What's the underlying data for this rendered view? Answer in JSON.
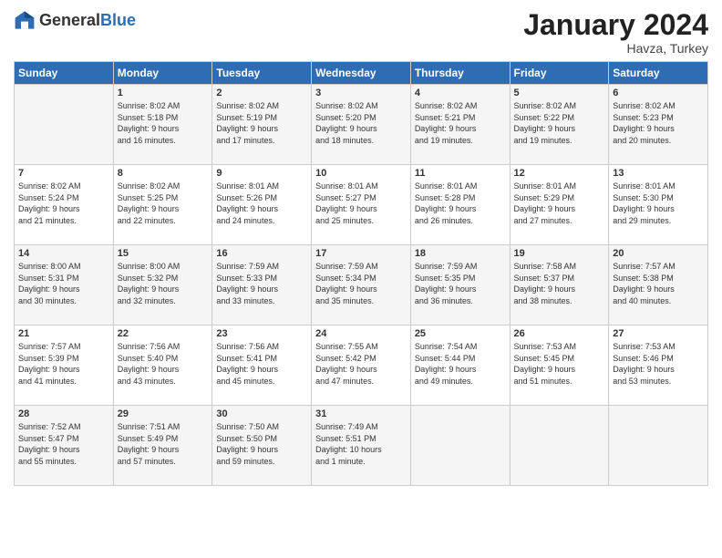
{
  "header": {
    "logo_general": "General",
    "logo_blue": "Blue",
    "month_title": "January 2024",
    "location": "Havza, Turkey"
  },
  "days_of_week": [
    "Sunday",
    "Monday",
    "Tuesday",
    "Wednesday",
    "Thursday",
    "Friday",
    "Saturday"
  ],
  "weeks": [
    [
      {
        "day": "",
        "info": ""
      },
      {
        "day": "1",
        "info": "Sunrise: 8:02 AM\nSunset: 5:18 PM\nDaylight: 9 hours\nand 16 minutes."
      },
      {
        "day": "2",
        "info": "Sunrise: 8:02 AM\nSunset: 5:19 PM\nDaylight: 9 hours\nand 17 minutes."
      },
      {
        "day": "3",
        "info": "Sunrise: 8:02 AM\nSunset: 5:20 PM\nDaylight: 9 hours\nand 18 minutes."
      },
      {
        "day": "4",
        "info": "Sunrise: 8:02 AM\nSunset: 5:21 PM\nDaylight: 9 hours\nand 19 minutes."
      },
      {
        "day": "5",
        "info": "Sunrise: 8:02 AM\nSunset: 5:22 PM\nDaylight: 9 hours\nand 19 minutes."
      },
      {
        "day": "6",
        "info": "Sunrise: 8:02 AM\nSunset: 5:23 PM\nDaylight: 9 hours\nand 20 minutes."
      }
    ],
    [
      {
        "day": "7",
        "info": "Sunrise: 8:02 AM\nSunset: 5:24 PM\nDaylight: 9 hours\nand 21 minutes."
      },
      {
        "day": "8",
        "info": "Sunrise: 8:02 AM\nSunset: 5:25 PM\nDaylight: 9 hours\nand 22 minutes."
      },
      {
        "day": "9",
        "info": "Sunrise: 8:01 AM\nSunset: 5:26 PM\nDaylight: 9 hours\nand 24 minutes."
      },
      {
        "day": "10",
        "info": "Sunrise: 8:01 AM\nSunset: 5:27 PM\nDaylight: 9 hours\nand 25 minutes."
      },
      {
        "day": "11",
        "info": "Sunrise: 8:01 AM\nSunset: 5:28 PM\nDaylight: 9 hours\nand 26 minutes."
      },
      {
        "day": "12",
        "info": "Sunrise: 8:01 AM\nSunset: 5:29 PM\nDaylight: 9 hours\nand 27 minutes."
      },
      {
        "day": "13",
        "info": "Sunrise: 8:01 AM\nSunset: 5:30 PM\nDaylight: 9 hours\nand 29 minutes."
      }
    ],
    [
      {
        "day": "14",
        "info": "Sunrise: 8:00 AM\nSunset: 5:31 PM\nDaylight: 9 hours\nand 30 minutes."
      },
      {
        "day": "15",
        "info": "Sunrise: 8:00 AM\nSunset: 5:32 PM\nDaylight: 9 hours\nand 32 minutes."
      },
      {
        "day": "16",
        "info": "Sunrise: 7:59 AM\nSunset: 5:33 PM\nDaylight: 9 hours\nand 33 minutes."
      },
      {
        "day": "17",
        "info": "Sunrise: 7:59 AM\nSunset: 5:34 PM\nDaylight: 9 hours\nand 35 minutes."
      },
      {
        "day": "18",
        "info": "Sunrise: 7:59 AM\nSunset: 5:35 PM\nDaylight: 9 hours\nand 36 minutes."
      },
      {
        "day": "19",
        "info": "Sunrise: 7:58 AM\nSunset: 5:37 PM\nDaylight: 9 hours\nand 38 minutes."
      },
      {
        "day": "20",
        "info": "Sunrise: 7:57 AM\nSunset: 5:38 PM\nDaylight: 9 hours\nand 40 minutes."
      }
    ],
    [
      {
        "day": "21",
        "info": "Sunrise: 7:57 AM\nSunset: 5:39 PM\nDaylight: 9 hours\nand 41 minutes."
      },
      {
        "day": "22",
        "info": "Sunrise: 7:56 AM\nSunset: 5:40 PM\nDaylight: 9 hours\nand 43 minutes."
      },
      {
        "day": "23",
        "info": "Sunrise: 7:56 AM\nSunset: 5:41 PM\nDaylight: 9 hours\nand 45 minutes."
      },
      {
        "day": "24",
        "info": "Sunrise: 7:55 AM\nSunset: 5:42 PM\nDaylight: 9 hours\nand 47 minutes."
      },
      {
        "day": "25",
        "info": "Sunrise: 7:54 AM\nSunset: 5:44 PM\nDaylight: 9 hours\nand 49 minutes."
      },
      {
        "day": "26",
        "info": "Sunrise: 7:53 AM\nSunset: 5:45 PM\nDaylight: 9 hours\nand 51 minutes."
      },
      {
        "day": "27",
        "info": "Sunrise: 7:53 AM\nSunset: 5:46 PM\nDaylight: 9 hours\nand 53 minutes."
      }
    ],
    [
      {
        "day": "28",
        "info": "Sunrise: 7:52 AM\nSunset: 5:47 PM\nDaylight: 9 hours\nand 55 minutes."
      },
      {
        "day": "29",
        "info": "Sunrise: 7:51 AM\nSunset: 5:49 PM\nDaylight: 9 hours\nand 57 minutes."
      },
      {
        "day": "30",
        "info": "Sunrise: 7:50 AM\nSunset: 5:50 PM\nDaylight: 9 hours\nand 59 minutes."
      },
      {
        "day": "31",
        "info": "Sunrise: 7:49 AM\nSunset: 5:51 PM\nDaylight: 10 hours\nand 1 minute."
      },
      {
        "day": "",
        "info": ""
      },
      {
        "day": "",
        "info": ""
      },
      {
        "day": "",
        "info": ""
      }
    ]
  ]
}
